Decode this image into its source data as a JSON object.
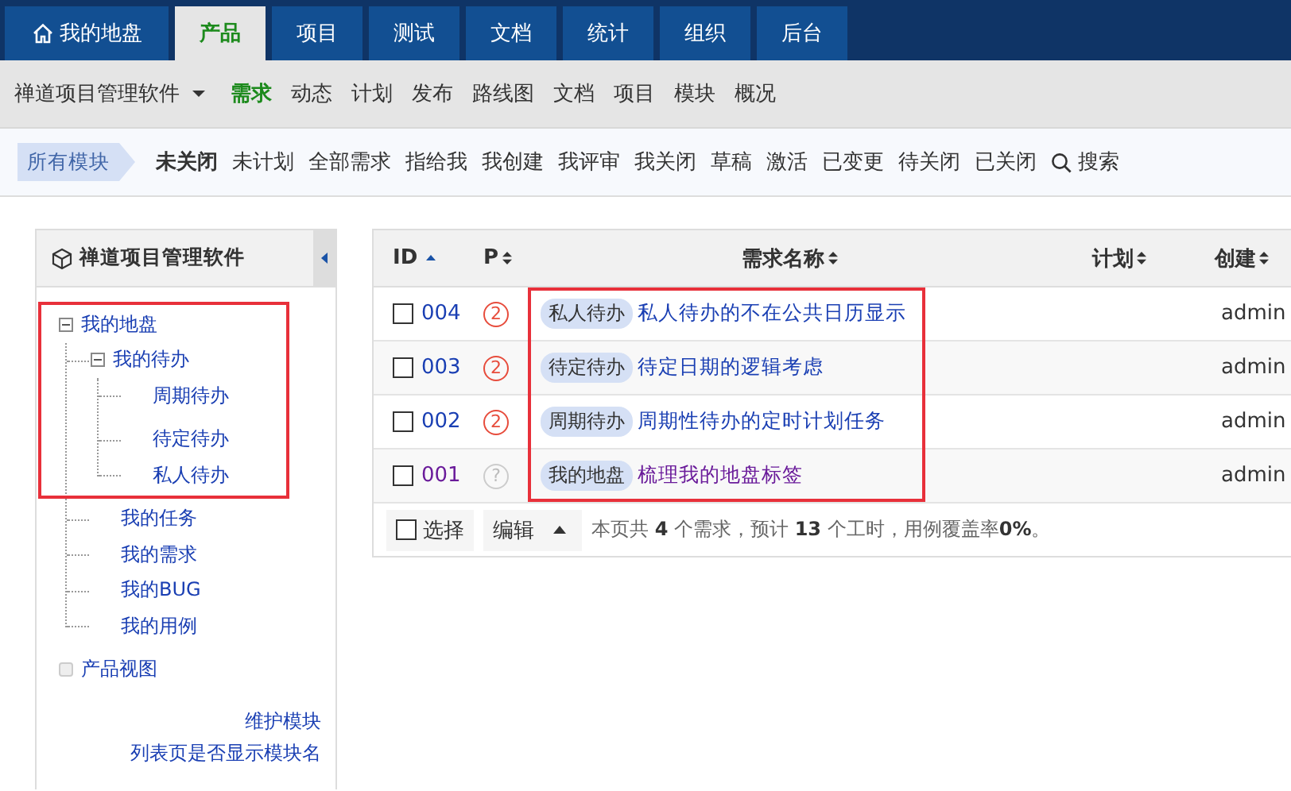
{
  "main_nav": [
    {
      "label": "我的地盘",
      "selected": false
    },
    {
      "label": "产品",
      "selected": true
    },
    {
      "label": "项目",
      "selected": false
    },
    {
      "label": "测试",
      "selected": false
    },
    {
      "label": "文档",
      "selected": false
    },
    {
      "label": "统计",
      "selected": false
    },
    {
      "label": "组织",
      "selected": false
    },
    {
      "label": "后台",
      "selected": false
    }
  ],
  "sub_nav": {
    "product": "禅道项目管理软件",
    "items": [
      {
        "label": "需求",
        "selected": true
      },
      {
        "label": "动态",
        "selected": false
      },
      {
        "label": "计划",
        "selected": false
      },
      {
        "label": "发布",
        "selected": false
      },
      {
        "label": "路线图",
        "selected": false
      },
      {
        "label": "文档",
        "selected": false
      },
      {
        "label": "项目",
        "selected": false
      },
      {
        "label": "模块",
        "selected": false
      },
      {
        "label": "概况",
        "selected": false
      }
    ]
  },
  "filter_bar": {
    "module": "所有模块",
    "filters": [
      {
        "label": "未关闭",
        "selected": true
      },
      {
        "label": "未计划",
        "selected": false
      },
      {
        "label": "全部需求",
        "selected": false
      },
      {
        "label": "指给我",
        "selected": false
      },
      {
        "label": "我创建",
        "selected": false
      },
      {
        "label": "我评审",
        "selected": false
      },
      {
        "label": "我关闭",
        "selected": false
      },
      {
        "label": "草稿",
        "selected": false
      },
      {
        "label": "激活",
        "selected": false
      },
      {
        "label": "已变更",
        "selected": false
      },
      {
        "label": "待关闭",
        "selected": false
      },
      {
        "label": "已关闭",
        "selected": false
      }
    ],
    "search": "搜索"
  },
  "sidebar": {
    "title": "禅道项目管理软件",
    "tree_framed": true,
    "tree": [
      {
        "label": "我的地盘",
        "expanded": true,
        "children": [
          {
            "label": "我的待办",
            "expanded": true,
            "children": [
              {
                "label": "周期待办"
              },
              {
                "label": "待定待办"
              },
              {
                "label": "私人待办"
              }
            ]
          },
          {
            "label": "我的任务"
          },
          {
            "label": "我的需求"
          },
          {
            "label": "我的BUG"
          },
          {
            "label": "我的用例"
          }
        ]
      },
      {
        "label": "产品视图",
        "expanded": false
      }
    ],
    "links": [
      "维护模块",
      "列表页是否显示模块名"
    ]
  },
  "table": {
    "titles_framed": true,
    "columns": [
      {
        "label": "ID",
        "sorted": true
      },
      {
        "label": "P",
        "sorted": false
      },
      {
        "label": "需求名称",
        "sorted": false
      },
      {
        "label": "计划",
        "sorted": false
      },
      {
        "label": "创建",
        "sorted": false
      }
    ],
    "rows": [
      {
        "checked": false,
        "id": "004",
        "priority": {
          "label": "2",
          "kind": "set"
        },
        "tag": "私人待办",
        "name": "私人待办的不在公共日历显示",
        "visited": false,
        "creator": "admin"
      },
      {
        "checked": false,
        "id": "003",
        "priority": {
          "label": "2",
          "kind": "set"
        },
        "tag": "待定待办",
        "name": "待定日期的逻辑考虑",
        "visited": false,
        "creator": "admin"
      },
      {
        "checked": false,
        "id": "002",
        "priority": {
          "label": "2",
          "kind": "set"
        },
        "tag": "周期待办",
        "name": "周期性待办的定时计划任务",
        "visited": false,
        "creator": "admin"
      },
      {
        "checked": false,
        "id": "001",
        "priority": {
          "label": "?",
          "kind": "unset"
        },
        "tag": "我的地盘",
        "name": "梳理我的地盘标签",
        "visited": true,
        "creator": "admin"
      }
    ],
    "footer": {
      "select_all": {
        "label": "选择",
        "checked": false
      },
      "edit": "编辑",
      "summary": "本页共 **4** 个需求，预计 **13** 个工时，用例覆盖率**0%**。"
    }
  }
}
